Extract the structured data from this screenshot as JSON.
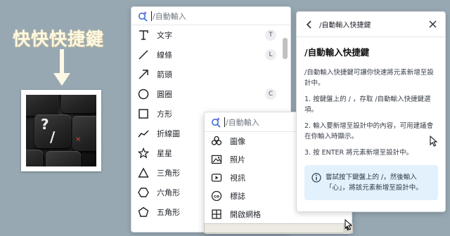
{
  "banner": {
    "title": "快快快捷鍵"
  },
  "photo": {
    "keys": [
      "?",
      "/"
    ]
  },
  "shape_panel": {
    "search_placeholder": "/自動輸入",
    "items": [
      {
        "label": "文字",
        "icon": "text-icon",
        "shortcut": "T"
      },
      {
        "label": "線條",
        "icon": "line-icon",
        "shortcut": "L"
      },
      {
        "label": "箭頭",
        "icon": "arrow-icon",
        "shortcut": ""
      },
      {
        "label": "圓圈",
        "icon": "circle-icon",
        "shortcut": "C"
      },
      {
        "label": "方形",
        "icon": "square-icon",
        "shortcut": ""
      },
      {
        "label": "折線圖",
        "icon": "line-chart-icon",
        "shortcut": ""
      },
      {
        "label": "星星",
        "icon": "star-icon",
        "shortcut": ""
      },
      {
        "label": "三角形",
        "icon": "triangle-icon",
        "shortcut": ""
      },
      {
        "label": "六角形",
        "icon": "hexagon-icon",
        "shortcut": ""
      },
      {
        "label": "五角形",
        "icon": "pentagon-icon",
        "shortcut": ""
      }
    ]
  },
  "insert_panel": {
    "search_placeholder": "/自動輸入",
    "items": [
      {
        "label": "圖像",
        "icon": "graphic-icon"
      },
      {
        "label": "照片",
        "icon": "photo-icon"
      },
      {
        "label": "視訊",
        "icon": "video-icon"
      },
      {
        "label": "標誌",
        "icon": "logo-icon"
      },
      {
        "label": "開啟網格",
        "icon": "grid-icon"
      }
    ]
  },
  "help_panel": {
    "header_title": "/自動輸入快捷鍵",
    "heading": "/自動輸入快捷鍵",
    "intro": "/自動輸入快捷鍵可讓你快速將元素新增至設計中。",
    "steps": [
      "1. 按鍵盤上的 / ，存取 /自動輸入快捷鍵選項。",
      "2. 輸入要新增至設計中的內容，可用建議會在你輸入時顯示。",
      "3. 按 ENTER 將元素新增至設計中。"
    ],
    "tip": "嘗試按下鍵盤上的 /，然後輸入「心」，將該元素新增至設計中。"
  },
  "colors": {
    "background": "#97a8b3",
    "accent": "#2f6fe0",
    "tip_background": "#e2f1fb"
  }
}
